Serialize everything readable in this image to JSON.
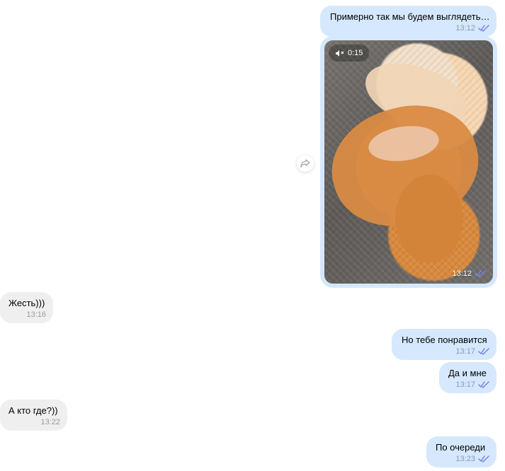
{
  "messages": [
    {
      "text": "Примерно так мы будем выглядеть…",
      "time": "13:12",
      "direction": "outgoing"
    },
    {
      "text": "Жесть)))",
      "time": "13:16",
      "direction": "incoming"
    },
    {
      "text": "Но тебе понравится",
      "time": "13:17",
      "direction": "outgoing"
    },
    {
      "text": "Да и мне",
      "time": "13:17",
      "direction": "outgoing"
    },
    {
      "text": "А кто где?))",
      "time": "13:22",
      "direction": "incoming"
    },
    {
      "text": "По очереди",
      "time": "13:23",
      "direction": "outgoing"
    }
  ],
  "video": {
    "duration": "0:15",
    "time": "13:12",
    "muted": true,
    "status": "read"
  },
  "colors": {
    "outgoing_bubble": "#d5e8fd",
    "incoming_bubble": "#efefef",
    "read_check": "#6f7eea"
  },
  "icons": {
    "read_receipt": "double-check-icon",
    "mute": "speaker-muted-icon",
    "share": "share-forward-icon"
  }
}
